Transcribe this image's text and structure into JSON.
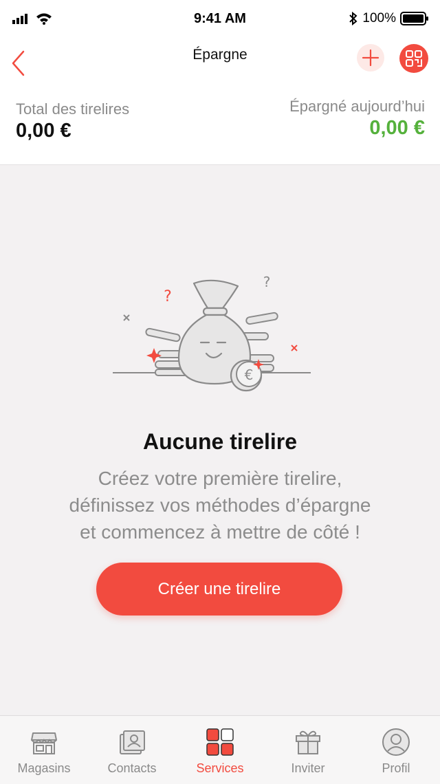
{
  "status_bar": {
    "time": "9:41 AM",
    "battery": "100%"
  },
  "nav": {
    "title": "Épargne",
    "back_icon": "chevron-left-icon",
    "add_icon": "plus-icon",
    "qr_icon": "qr-code-icon"
  },
  "summary": {
    "total_label": "Total des tirelires",
    "total_value": "0,00 €",
    "today_label": "Épargné aujourd’hui",
    "today_value": "0,00 €"
  },
  "empty_state": {
    "title": "Aucune tirelire",
    "description_lines": [
      "Créez votre première tirelire,",
      "définissez vos méthodes d’épargne",
      "et commencez à mettre de côté !"
    ],
    "button_label": "Créer une tirelire"
  },
  "tabs": [
    {
      "label": "Magasins",
      "icon": "store-icon",
      "active": false
    },
    {
      "label": "Contacts",
      "icon": "contacts-icon",
      "active": false
    },
    {
      "label": "Services",
      "icon": "services-grid-icon",
      "active": true
    },
    {
      "label": "Inviter",
      "icon": "gift-icon",
      "active": false
    },
    {
      "label": "Profil",
      "icon": "profile-icon",
      "active": false
    }
  ],
  "colors": {
    "accent": "#f24b3f",
    "positive": "#55b13c",
    "muted_text": "#8c8c8c",
    "background": "#f3f1f2"
  }
}
